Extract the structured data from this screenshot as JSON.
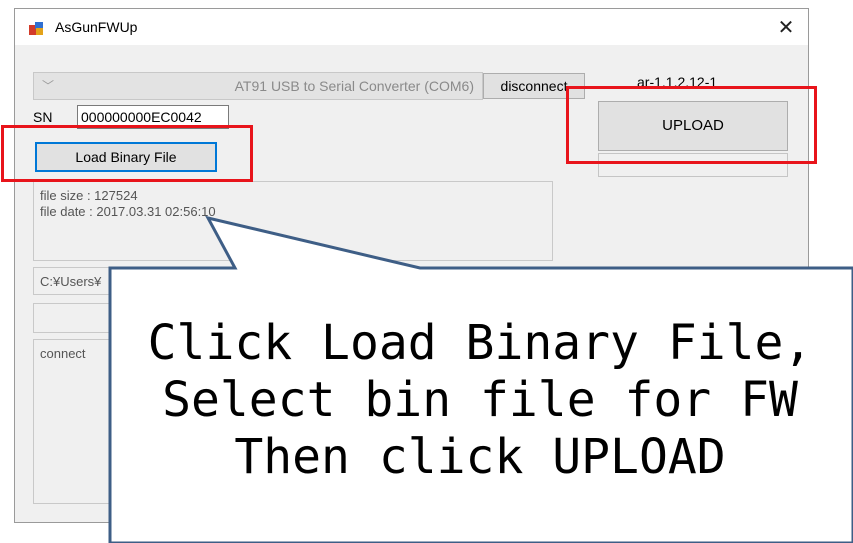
{
  "window": {
    "title": "AsGunFWUp",
    "close_glyph": "✕"
  },
  "port": {
    "selected": "AT91 USB to Serial Converter (COM6)"
  },
  "buttons": {
    "disconnect": "disconnect",
    "upload": "UPLOAD",
    "load_binary": "Load Binary File"
  },
  "version": "ar-1.1.2.12-1",
  "serial": {
    "label": "SN",
    "value": "000000000EC0042"
  },
  "file_info": {
    "size_line": "file size : 127524",
    "date_line": "file date : 2017.03.31 02:56:10"
  },
  "path_text": "C:¥Users¥",
  "log_text": "connect",
  "callout": {
    "line1": "Click Load Binary File,",
    "line2": "Select bin file for FW",
    "line3": "Then click UPLOAD"
  },
  "colors": {
    "highlight": "#e8141b",
    "callout_border": "#3e5e86",
    "focus": "#0078d7"
  },
  "icons": {
    "app": "app-icon",
    "close": "close-icon",
    "chevron": "chevron-down-icon"
  }
}
